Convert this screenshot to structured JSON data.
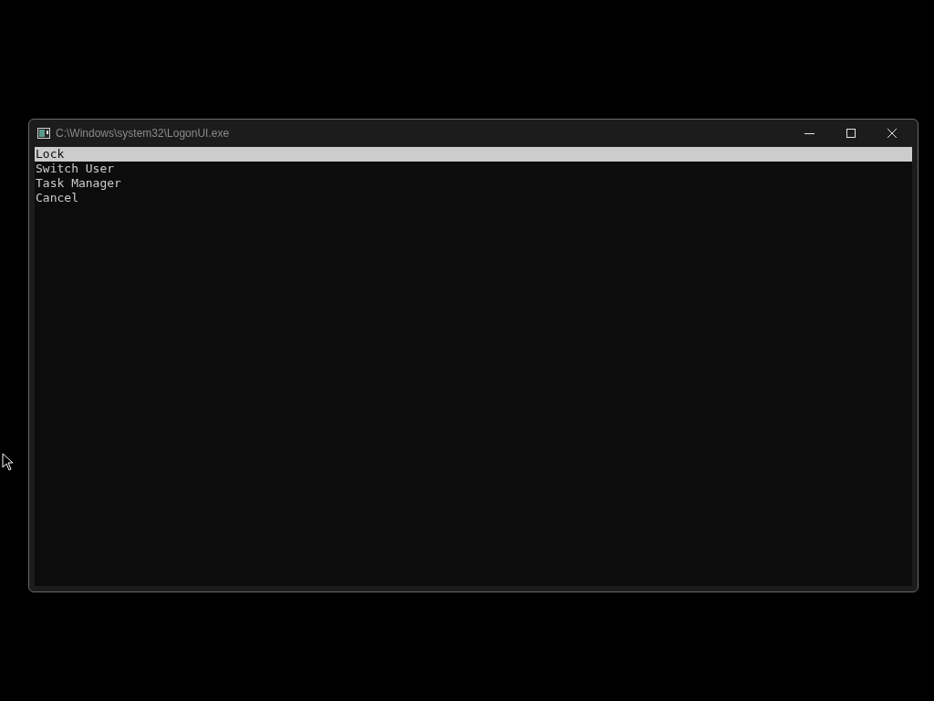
{
  "window": {
    "title": "C:\\Windows\\system32\\LogonUI.exe"
  },
  "menu": [
    {
      "label": "Lock",
      "selected": true
    },
    {
      "label": "Switch User",
      "selected": false
    },
    {
      "label": "Task Manager",
      "selected": false
    },
    {
      "label": "Cancel",
      "selected": false
    }
  ]
}
